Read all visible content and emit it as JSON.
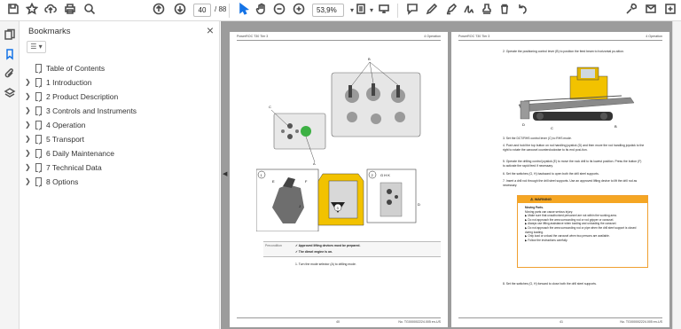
{
  "toolbar": {
    "page_current": "40",
    "page_total": "/ 88",
    "zoom": "53,9%",
    "buttons": [
      "save",
      "bookmark",
      "upload",
      "print",
      "search",
      "page-up",
      "page-down",
      "select",
      "hand",
      "zoom-out",
      "zoom-in",
      "zoom-dropdown",
      "fit",
      "fit-dropdown",
      "scroll-mode",
      "comment",
      "pen",
      "highlight",
      "sign",
      "stamp",
      "delete",
      "undo",
      "tools",
      "email",
      "more"
    ]
  },
  "bookmarks": {
    "title": "Bookmarks",
    "items": [
      {
        "label": "Table of Contents",
        "expandable": false
      },
      {
        "label": "1 Introduction",
        "expandable": true
      },
      {
        "label": "2 Product Description",
        "expandable": true
      },
      {
        "label": "3 Controls and Instruments",
        "expandable": true
      },
      {
        "label": "4 Operation",
        "expandable": true
      },
      {
        "label": "5 Transport",
        "expandable": true
      },
      {
        "label": "6 Daily Maintenance",
        "expandable": true
      },
      {
        "label": "7 Technical Data",
        "expandable": true
      },
      {
        "label": "8 Options",
        "expandable": true
      }
    ]
  },
  "left_page": {
    "header_left": "PowerROC T30 Tier 3",
    "header_right": "4 Operation",
    "footer_page": "40",
    "footer_ref": "No. TG000002224.005 en-US",
    "prereq_label": "Precondition",
    "prereq_1": "Approved lifting devices must be prepared.",
    "prereq_2": "The diesel engine is on.",
    "step_1": "1.  Turn the mode selector (A) to drilling mode.",
    "callouts": [
      "B",
      "C",
      "A",
      "1",
      "E",
      "F",
      "J",
      "2",
      "G",
      "H",
      "K",
      "D",
      "1",
      "2",
      "3"
    ]
  },
  "right_page": {
    "header_left": "PowerROC T30 Tier 3",
    "header_right": "4 Operation",
    "footer_page": "41",
    "footer_ref": "No. TG000002224.005 en-US",
    "step_2": "2.  Operate the positioning control lever (B) to position the feed beam to horizontal po-sition.",
    "step_3": "3.  Set the DCT/RHS control lever (C) to RHS mode.",
    "step_4": "4.  Push and hold the top button on rod handling joystick (D) and then move the rod handling joystick to the right to rotate the carousel counterclockwise to its end posi-tion.",
    "step_5": "5.  Operate the drilling control joystick (E) to move the rock drill to its lowest position. Press the button (F) to activate the rapid feed if necessary.",
    "step_6": "6.  Set the switches (G, H) backward to open both the drill steel supports.",
    "step_7": "7.  Insert a drill rod through the drill steel supports. Use an approved lifting device to lift the drill rod as necessary.",
    "warning_title": "WARNING",
    "warning_sub": "Moving Parts.",
    "warning_text": "Moving parts can cause serious injury.",
    "warning_items": [
      "Make sure that unauthorized personnel are not within the working area.",
      "Do not approach the area surrounding rod or rod gripper or carousel.",
      "Always use lifting assistance when loading and unloading the carousel.",
      "Do not approach the area surrounding rod or pipe when the drill steel support is closed during loading.",
      "Only load or unload the carousel when two persons are available.",
      "Follow the instructions carefully."
    ],
    "step_8": "8.  Set the switches (G, H) forward to close both the drill steel supports."
  },
  "colors": {
    "accent": "#f5a623",
    "viewer_bg": "#9c9c9c",
    "green_button": "#3cb043"
  }
}
